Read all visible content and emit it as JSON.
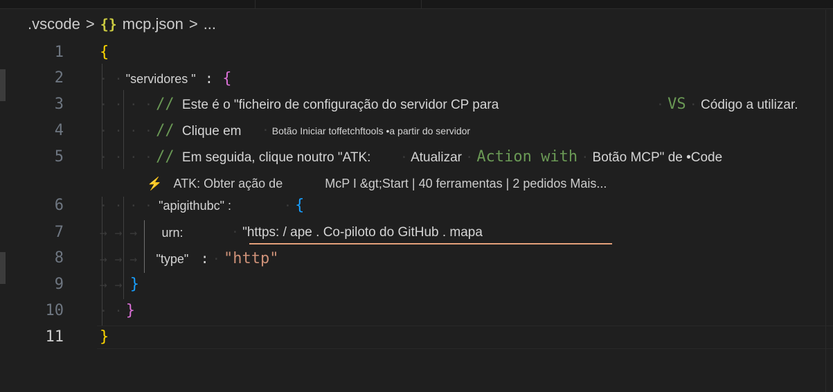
{
  "breadcrumb": {
    "folder": ".vscode",
    "sep": ">",
    "file_icon": "{}",
    "file": "mcp.json",
    "more": "..."
  },
  "line_numbers": [
    "1",
    "2",
    "3",
    "4",
    "5",
    "6",
    "7",
    "8",
    "9",
    "10",
    "11"
  ],
  "active_line": "11",
  "code": {
    "l1_brace": "{",
    "l2_key": "\"servidores \"",
    "l2_colon": ":",
    "l2_brace": "{",
    "comment_marker": "//",
    "l3_text": "Este é o \"ficheiro de configuração do servidor CP para",
    "l3_vs": "VS",
    "l3_tail": "Código a utilizar.",
    "l4_text": "Clique em",
    "l4_small": "Botão Iniciar toffetchftools •a partir do servidor",
    "l5_text": "Em seguida, clique noutro \"ATK:",
    "l5_mid": "Atualizar",
    "l5_mono": "Action with",
    "l5_tail": "Botão MCP\" de •Code",
    "lens_label": "ATK:",
    "lens_action": "Obter ação de",
    "lens_status": "McP I &gt;Start | 40 ferramentas | 2 pedidos Mais...",
    "l6_key": "\"apigithubc\" :",
    "l6_brace": "{",
    "l7_key": "urn:",
    "l7_value": "\"https: / ape . Co-piloto do GitHub . mapa",
    "l8_key": "\"type\"",
    "l8_colon": ":",
    "l8_value": "\"http\"",
    "l9_brace": "}",
    "l10_brace": "}",
    "l11_brace": "}"
  },
  "icons": {
    "codelens": "lightning-bolt-icon",
    "file": "json-braces-icon"
  },
  "colors": {
    "background": "#1f1f1f",
    "bracket_level1": "#ffd700",
    "bracket_level2": "#da70d6",
    "bracket_level3": "#179fff",
    "comment": "#6a9955",
    "string": "#ce9178",
    "bolt": "#e8793b"
  }
}
